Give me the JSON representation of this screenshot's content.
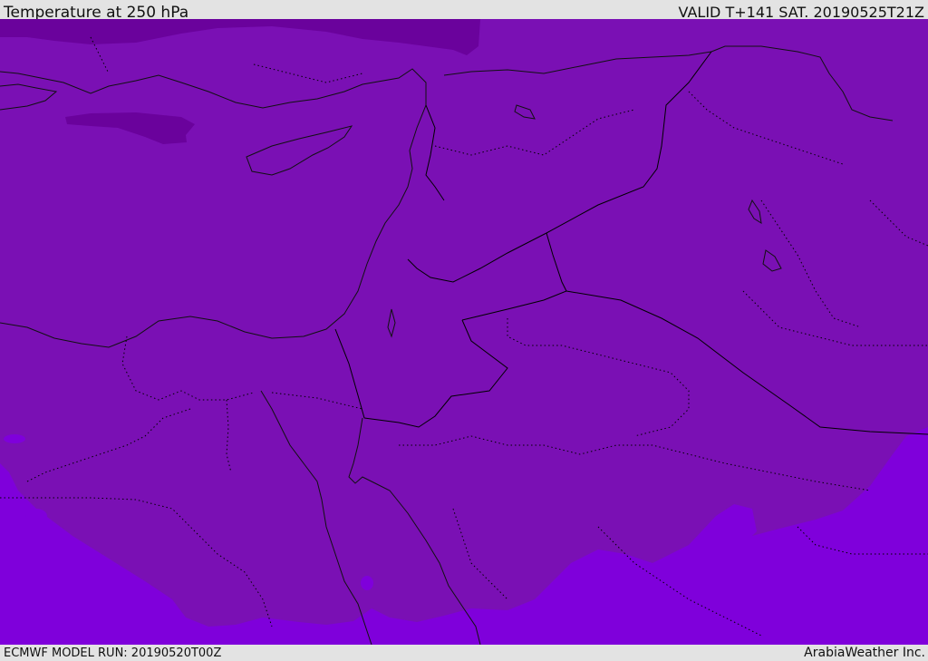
{
  "header": {
    "title": "Temperature at 250 hPa",
    "valid": "VALID T+141 SAT. 20190525T21Z"
  },
  "footer": {
    "model_run": "ECMWF MODEL RUN: 20190520T00Z",
    "credit": "ArabiaWeather Inc."
  },
  "map": {
    "colors": {
      "base": "#7a10b4",
      "cold": "#6a029c",
      "warm": "#7f00db",
      "coast": "#111111",
      "border": "#000000"
    },
    "icons": [
      "coastline",
      "country-border",
      "province-border",
      "temperature-band"
    ]
  }
}
